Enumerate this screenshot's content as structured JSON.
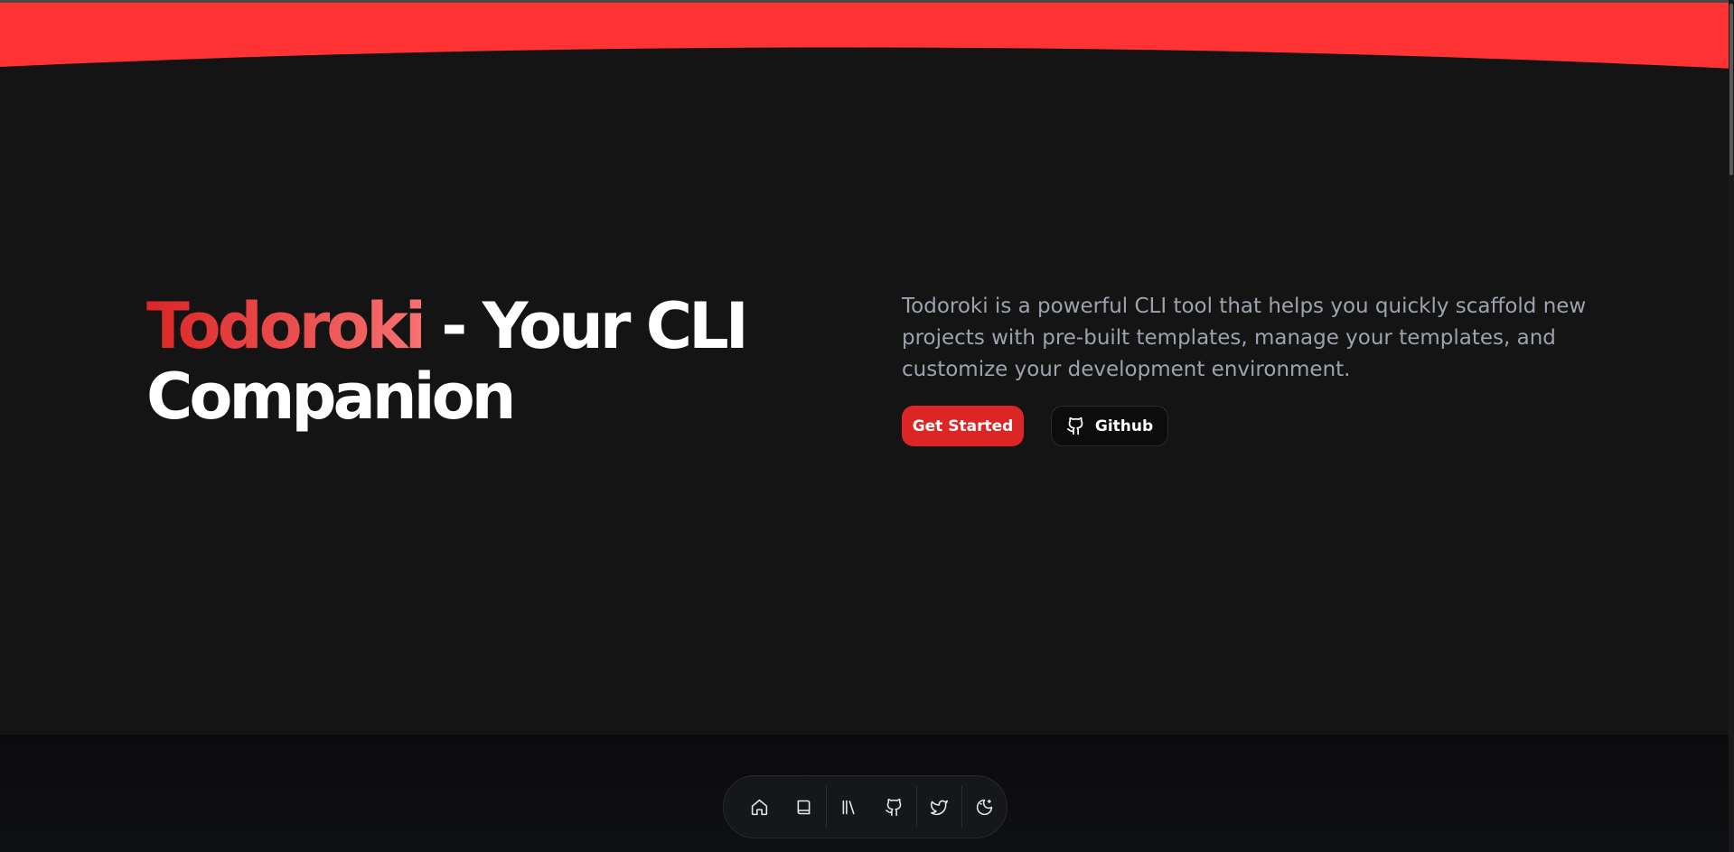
{
  "colors": {
    "accent": "#dc2626",
    "banner": "#ff3333",
    "background": "#141414",
    "text_muted": "#9ca3af"
  },
  "hero": {
    "title_brand": "Todoroki",
    "title_rest": " - Your CLI Companion",
    "description": "Todoroki is a powerful CLI tool that helps you quickly scaffold new projects with pre-built templates, manage your templates, and customize your development environment.",
    "primary_button": "Get Started",
    "github_button": "Github",
    "github_icon": "github-icon"
  },
  "dock": {
    "items": [
      {
        "icon": "home-icon"
      },
      {
        "icon": "book-icon"
      },
      {
        "icon": "library-icon"
      },
      {
        "icon": "github-icon"
      },
      {
        "icon": "twitter-icon"
      },
      {
        "icon": "theme-toggle-icon"
      }
    ]
  }
}
